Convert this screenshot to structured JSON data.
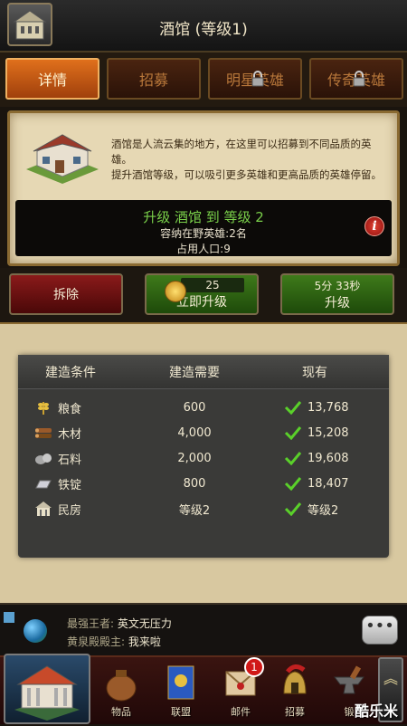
{
  "header": {
    "title": "酒馆 (等级1)"
  },
  "tabs": [
    {
      "label": "详情",
      "active": true,
      "locked": false
    },
    {
      "label": "招募",
      "active": false,
      "locked": false
    },
    {
      "label": "明星英雄",
      "active": false,
      "locked": true
    },
    {
      "label": "传奇英雄",
      "active": false,
      "locked": true
    }
  ],
  "info": {
    "description_1": "酒馆是人流云集的地方，在这里可以招募到不同品质的英雄。",
    "description_2": "提升酒馆等级，可以吸引更多英雄和更高品质的英雄停留。",
    "upgrade_title": "升级 酒馆 到 等级 2",
    "capacity": "容纳在野英雄:2名",
    "population": "占用人口:9",
    "info_icon_glyph": "i"
  },
  "actions": {
    "dismantle_label": "拆除",
    "instant_cost": "25",
    "instant_label": "立即升级",
    "upgrade_time": "5分 33秒",
    "upgrade_label": "升级"
  },
  "requirements": {
    "headers": [
      "建造条件",
      "建造需要",
      "现有"
    ],
    "rows": [
      {
        "name": "粮食",
        "icon": "wheat-icon",
        "need": "600",
        "have": "13,768"
      },
      {
        "name": "木材",
        "icon": "wood-icon",
        "need": "4,000",
        "have": "15,208"
      },
      {
        "name": "石料",
        "icon": "stone-icon",
        "need": "2,000",
        "have": "19,608"
      },
      {
        "name": "铁锭",
        "icon": "iron-icon",
        "need": "800",
        "have": "18,407"
      },
      {
        "name": "民房",
        "icon": "house-icon",
        "need": "等级2",
        "have": "等级2"
      }
    ]
  },
  "chat": {
    "line1_who": "最强王者:",
    "line1_text": "英文无压力",
    "line2_who": "黄泉殿殿主:",
    "line2_text": "我来啦",
    "more_glyph": "•••"
  },
  "nav": {
    "items": [
      {
        "label": "物品",
        "icon": "bag-icon"
      },
      {
        "label": "联盟",
        "icon": "banner-icon"
      },
      {
        "label": "邮件",
        "icon": "mail-icon",
        "badge": "1"
      },
      {
        "label": "招募",
        "icon": "helmet-icon"
      },
      {
        "label": "锻",
        "icon": "anvil-icon"
      }
    ],
    "more_glyph": "︽"
  },
  "watermark": "酷乐米",
  "colors": {
    "accent_tab": "#e0701c",
    "green_text": "#7ad04a",
    "check_green": "#5ad02a"
  }
}
